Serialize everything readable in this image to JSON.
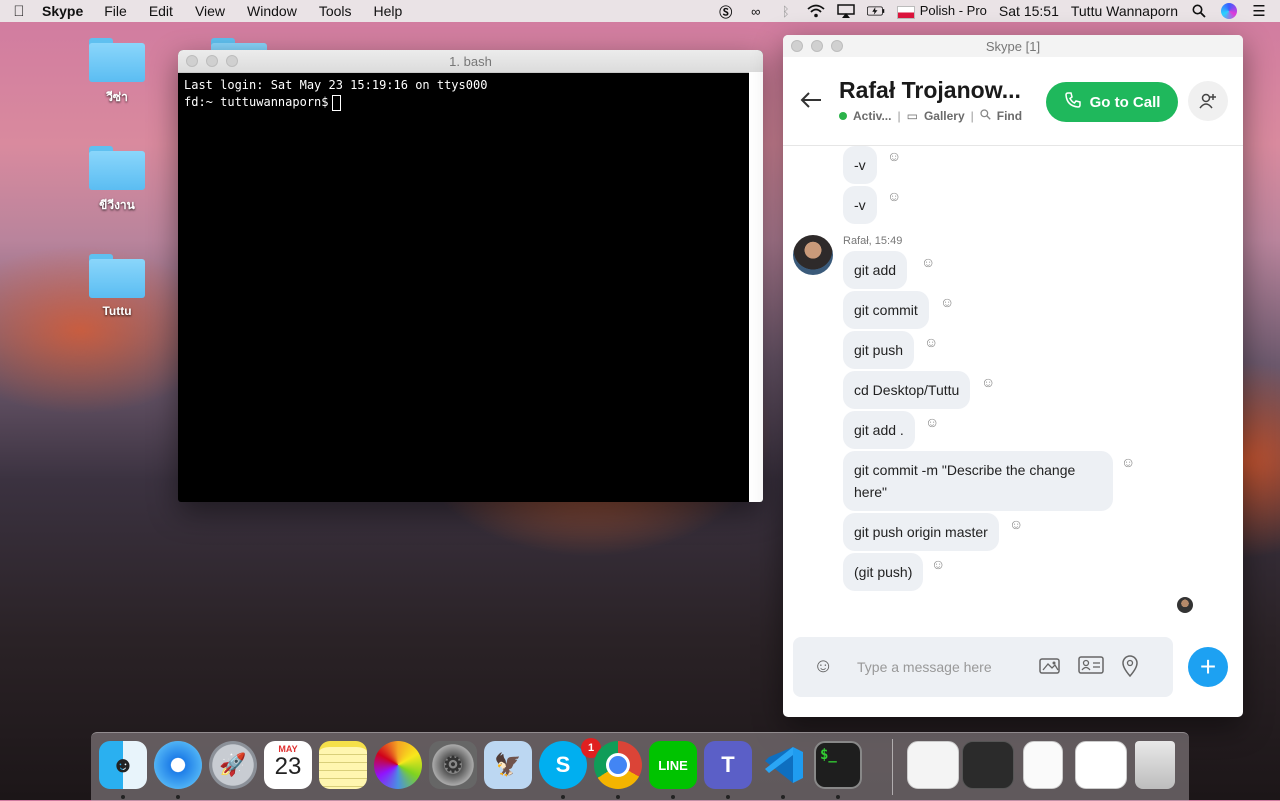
{
  "menubar": {
    "apple": "",
    "app_name": "Skype",
    "menus": [
      "File",
      "Edit",
      "View",
      "Window",
      "Tools",
      "Help"
    ],
    "input_source": "Polish - Pro",
    "clock": "Sat 15:51",
    "user": "Tuttu Wannaporn",
    "status_icons": [
      "skype-icon",
      "creative-cloud-icon",
      "bluetooth-icon",
      "wifi-icon",
      "airplay-icon",
      "battery-icon",
      "flag-icon",
      "spotlight-icon",
      "siri-icon",
      "notification-center-icon"
    ]
  },
  "desktop": {
    "folders": [
      {
        "label": "วีซ่า"
      },
      {
        "label": "ขีวีงาน"
      },
      {
        "label": "Tuttu"
      }
    ]
  },
  "terminal": {
    "title": "1. bash",
    "lines": [
      "Last login: Sat May 23 15:19:16 on ttys000",
      "fd:~ tuttuwannaporn$"
    ]
  },
  "skype": {
    "window_title": "Skype [1]",
    "contact_name": "Rafał Trojanow...",
    "status": "Activ...",
    "gallery_label": "Gallery",
    "find_label": "Find",
    "call_label": "Go to Call",
    "sender_line": "Rafał, 15:49",
    "messages_prev": [
      "-v",
      "-v"
    ],
    "messages": [
      "git add",
      "git commit",
      "git push",
      "cd Desktop/Tuttu",
      "git add .",
      "git commit -m \"Describe the change here\"",
      "git push origin master",
      "(git push)"
    ],
    "composer_placeholder": "Type a message here",
    "accent_color": "#1da1f2",
    "call_color": "#1fb85c"
  },
  "dock": {
    "apps": [
      "Finder",
      "Safari",
      "Launchpad",
      "Calendar",
      "Notes",
      "Photos",
      "System Preferences",
      "Preview",
      "Skype",
      "Chrome",
      "LINE",
      "Teams",
      "VS Code",
      "Terminal"
    ],
    "calendar_month": "MAY",
    "calendar_day": "23",
    "skype_badge": "1"
  }
}
